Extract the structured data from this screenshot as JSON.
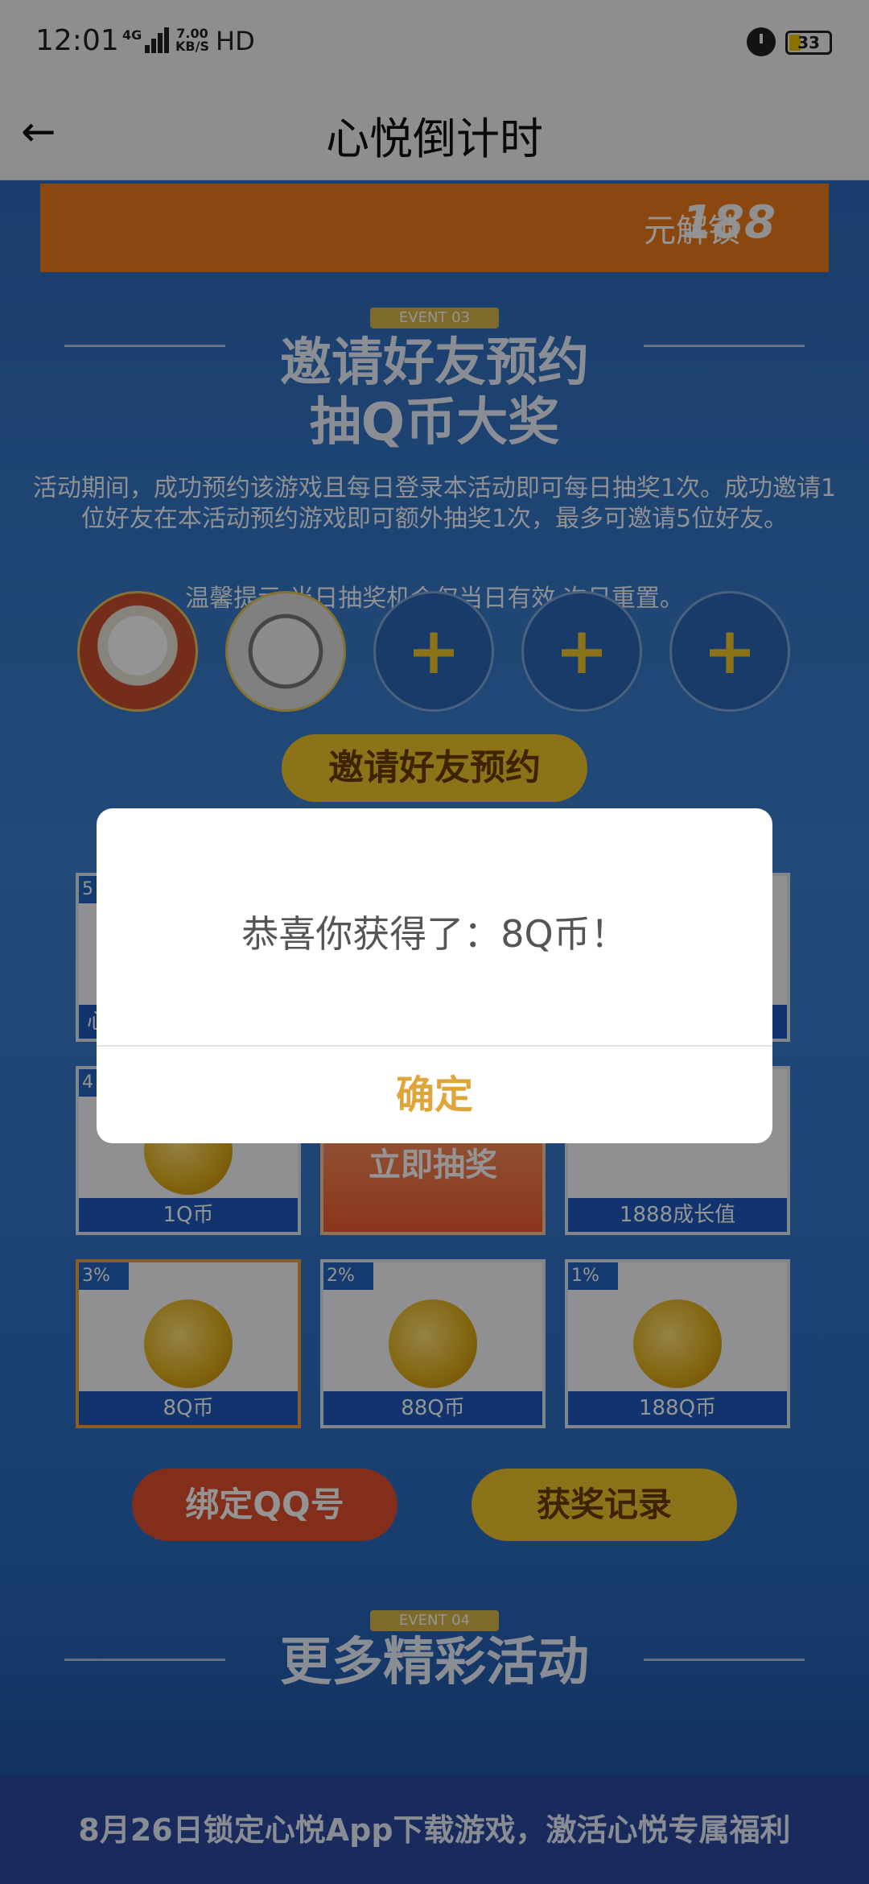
{
  "status_bar": {
    "time": "12:01",
    "network": "4G",
    "speed_value": "7.00",
    "speed_unit": "KB/S",
    "hd": "HD",
    "battery": "33"
  },
  "header": {
    "back_icon": "back-arrow-icon",
    "title": "心悦倒计时"
  },
  "banner": {
    "number": "188",
    "text": "元解锁"
  },
  "event3": {
    "tag": "EVENT 03",
    "title_line1": "邀请好友预约",
    "title_line2": "抽Q币大奖",
    "desc": "活动期间，成功预约该游戏且每日登录本活动即可每日抽奖1次。成功邀请1位好友在本活动预约游戏即可额外抽奖1次，最多可邀请5位好友。",
    "tip": "温馨提示:当日抽奖机会仅当日有效,次日重置。",
    "add_symbol": "+",
    "invite_button": "邀请好友预约"
  },
  "prizes": {
    "row2": [
      {
        "pct": "4",
        "label": "1Q币"
      },
      {
        "draw": "立即抽奖"
      },
      {
        "label": "1888成长值"
      }
    ],
    "row3": [
      {
        "pct": "3%",
        "label": "8Q币"
      },
      {
        "pct": "2%",
        "label": "88Q币"
      },
      {
        "pct": "1%",
        "label": "188Q币"
      }
    ],
    "row1_pct": "5",
    "row1_label_partial": "心"
  },
  "actions": {
    "bind_qq": "绑定QQ号",
    "records": "获奖记录"
  },
  "event4": {
    "tag": "EVENT 04",
    "title": "更多精彩活动"
  },
  "footer": {
    "text": "8月26日锁定心悦App下载游戏，激活心悦专属福利"
  },
  "dialog": {
    "message": "恭喜你获得了：8Q币！",
    "confirm": "确定"
  },
  "colors": {
    "accent": "#e0a53a",
    "page_blue": "#2e6cbc",
    "banner_orange": "#f07a1c"
  }
}
